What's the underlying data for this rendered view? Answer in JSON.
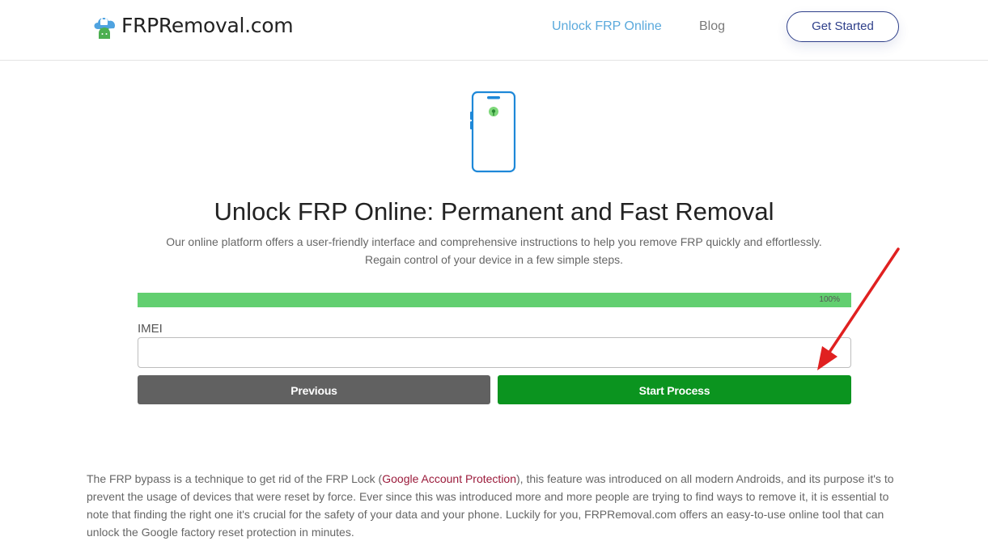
{
  "header": {
    "logo_text": "FRPRemoval.com",
    "logo_icon": "cloud-lock-android-icon",
    "nav": [
      {
        "label": "Unlock FRP Online",
        "active": true
      },
      {
        "label": "Blog",
        "active": false
      }
    ],
    "cta_label": "Get Started"
  },
  "hero": {
    "icon": "smartphone-icon",
    "title": "Unlock FRP Online: Permanent and Fast Removal",
    "subtitle_line1": "Our online platform offers a user-friendly interface and comprehensive instructions to help you remove FRP quickly and effortlessly.",
    "subtitle_line2": "Regain control of your device in a few simple steps."
  },
  "form": {
    "progress_percent": 100,
    "progress_label": "100%",
    "imei_label": "IMEI",
    "imei_value": "",
    "previous_label": "Previous",
    "start_label": "Start Process"
  },
  "annotation": {
    "icon": "red-arrow-icon",
    "color": "#e02020"
  },
  "article": {
    "text_before_link": "The FRP bypass is a technique to get rid of the FRP Lock (",
    "link_text": "Google Account Protection",
    "text_after_link": "), this feature was introduced on all modern Androids, and its purpose it's to prevent the usage of devices that were reset by force. Ever since this was introduced more and more people are trying to find ways to remove it, it is essential to note that finding the right one it's crucial for the safety of your data and your phone. Luckily for you, FRPRemoval.com offers an easy-to-use online tool that can unlock the Google factory reset protection in minutes."
  },
  "colors": {
    "accent_blue": "#5aa9dc",
    "cta_border": "#2e3f8a",
    "progress_green": "#62cf70",
    "start_green": "#0b941f",
    "previous_gray": "#616161",
    "link_red": "#9b1b3b"
  }
}
